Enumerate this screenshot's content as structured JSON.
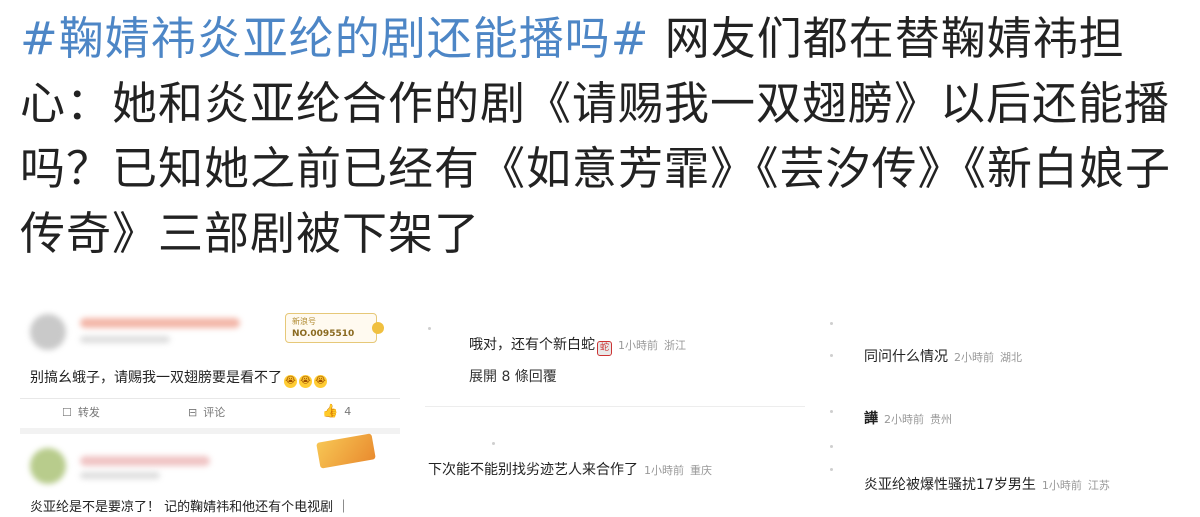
{
  "headline": {
    "hashtag": "#鞠婧祎炎亚纶的剧还能播吗#",
    "body": " 网友们都在替鞠婧祎担心：她和炎亚纶合作的剧《请赐我一双翅膀》以后还能播吗？已知她之前已经有《如意芳霏》《芸汐传》《新白娘子传奇》三部剧被下架了"
  },
  "left_panel": {
    "comment1": {
      "badge_title": "新浪号",
      "badge_number": "NO.0095510",
      "text": "别搞幺蛾子，请赐我一双翅膀要是看不了",
      "emojis": [
        "😭",
        "😭",
        "😭"
      ],
      "forward_label": "转发",
      "comment_label": "评论",
      "like_count": "4"
    },
    "comment2": {
      "text": "炎亚纶是不是要凉了！ 记的鞠婧祎和他还有个电视剧 ｜"
    }
  },
  "middle_panel": {
    "reply1": {
      "text": "哦对，还有个新白蛇",
      "time": "1小時前",
      "location": "浙江",
      "expand": "展開 8 條回覆"
    },
    "reply2": {
      "text": "下次能不能别找劣迹艺人来合作了",
      "time": "1小時前",
      "location": "重庆"
    }
  },
  "right_panel": {
    "reply1": {
      "text": "同问什么情况",
      "time": "2小時前",
      "location": "湖北"
    },
    "reply2": {
      "text": "譁",
      "time": "2小時前",
      "location": "贵州"
    },
    "reply3": {
      "text": "炎亚纶被爆性骚扰17岁男生",
      "time": "1小時前",
      "location": "江苏"
    }
  },
  "colors": {
    "hashtag": "#4d86c6",
    "meta": "#999999"
  }
}
